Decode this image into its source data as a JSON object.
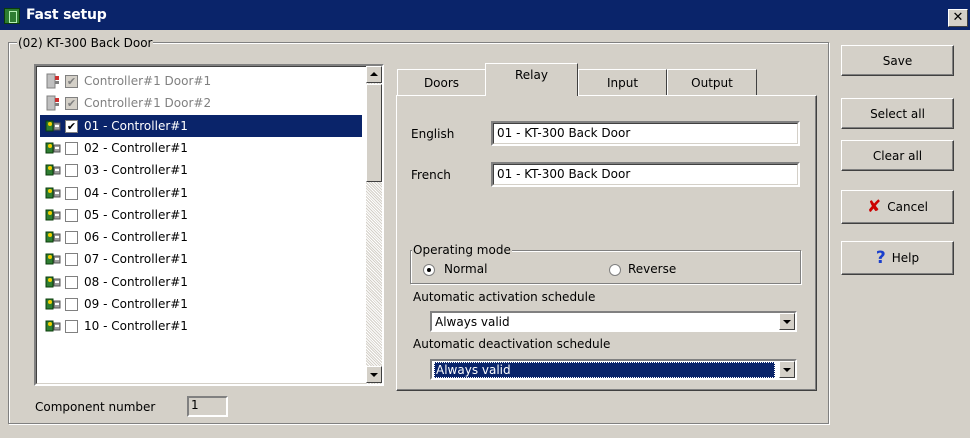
{
  "window": {
    "title": "Fast setup",
    "close_symbol": "✕"
  },
  "group": {
    "label": "(02) KT-300 Back Door"
  },
  "list_items": [
    {
      "label": "Controller#1 Door#1",
      "checked": true,
      "disabled": true,
      "selected": false,
      "icon": "door-icon"
    },
    {
      "label": "Controller#1 Door#2",
      "checked": true,
      "disabled": true,
      "selected": false,
      "icon": "door-icon"
    },
    {
      "label": "01 - Controller#1",
      "checked": true,
      "disabled": false,
      "selected": true,
      "icon": "relay-icon"
    },
    {
      "label": "02 - Controller#1",
      "checked": false,
      "disabled": false,
      "selected": false,
      "icon": "relay-icon"
    },
    {
      "label": "03 - Controller#1",
      "checked": false,
      "disabled": false,
      "selected": false,
      "icon": "relay-icon"
    },
    {
      "label": "04 - Controller#1",
      "checked": false,
      "disabled": false,
      "selected": false,
      "icon": "relay-icon"
    },
    {
      "label": "05 - Controller#1",
      "checked": false,
      "disabled": false,
      "selected": false,
      "icon": "relay-icon"
    },
    {
      "label": "06 - Controller#1",
      "checked": false,
      "disabled": false,
      "selected": false,
      "icon": "relay-icon"
    },
    {
      "label": "07 - Controller#1",
      "checked": false,
      "disabled": false,
      "selected": false,
      "icon": "relay-icon"
    },
    {
      "label": "08 - Controller#1",
      "checked": false,
      "disabled": false,
      "selected": false,
      "icon": "relay-icon"
    },
    {
      "label": "09 - Controller#1",
      "checked": false,
      "disabled": false,
      "selected": false,
      "icon": "relay-icon"
    },
    {
      "label": "10 - Controller#1",
      "checked": false,
      "disabled": false,
      "selected": false,
      "icon": "relay-icon"
    }
  ],
  "component": {
    "label": "Component number",
    "value": "1"
  },
  "tabs": [
    {
      "label": "Doors"
    },
    {
      "label": "Relay"
    },
    {
      "label": "Input"
    },
    {
      "label": "Output"
    }
  ],
  "active_tab": "Relay",
  "relay": {
    "english_label": "English",
    "english_value": "01 - KT-300 Back Door",
    "french_label": "French",
    "french_value": "01 - KT-300 Back Door",
    "operating_mode_label": "Operating mode",
    "mode_normal": "Normal",
    "mode_reverse": "Reverse",
    "selected_mode": "Normal",
    "activation_label": "Automatic activation schedule",
    "activation_value": "Always valid",
    "deactivation_label": "Automatic deactivation schedule",
    "deactivation_value": "Always valid"
  },
  "buttons": {
    "save": "Save",
    "select_all": "Select all",
    "clear_all": "Clear all",
    "cancel": "Cancel",
    "help": "Help"
  },
  "colors": {
    "title_bar": "#0a246a",
    "selection": "#0a246a",
    "face": "#d4d0c8",
    "cancel_x": "#cc0000",
    "help_q": "#0000cc"
  }
}
